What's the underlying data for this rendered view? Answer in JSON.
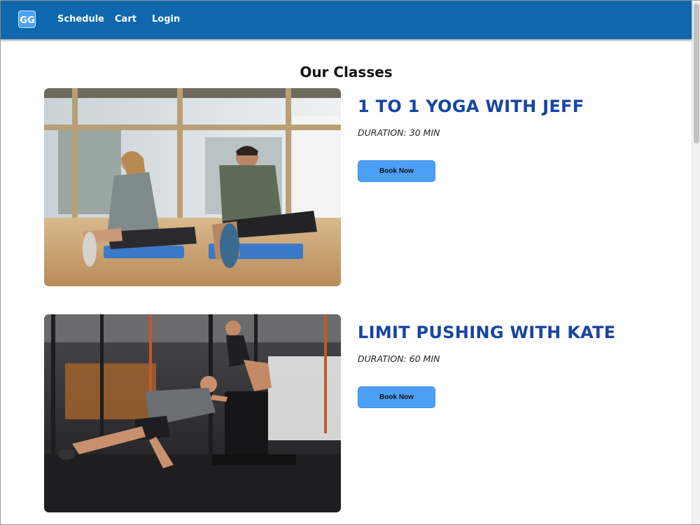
{
  "navbar": {
    "logo_text": "GG",
    "links": [
      {
        "label": "Schedule"
      },
      {
        "label": "Cart"
      },
      {
        "label": "Login"
      }
    ]
  },
  "page": {
    "title": "Our Classes"
  },
  "classes": [
    {
      "title": "1 TO 1 YOGA WITH JEFF",
      "duration": "DURATION: 30 MIN",
      "button_label": "Book Now"
    },
    {
      "title": "LIMIT PUSHING WITH KATE",
      "duration": "DURATION: 60 MIN",
      "button_label": "Book Now"
    }
  ],
  "colors": {
    "navbar": "#0f67ad",
    "title_accent": "#1746a2",
    "button": "#4b9ff5"
  }
}
